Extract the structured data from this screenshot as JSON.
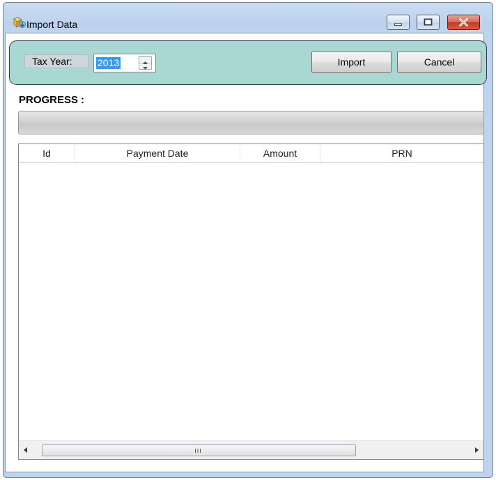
{
  "window": {
    "title": "Import Data",
    "icon": "import-data-icon",
    "caption_buttons": [
      "minimize-icon",
      "maximize-icon",
      "close-icon"
    ]
  },
  "toolbar": {
    "tax_year_label": "Tax Year:",
    "tax_year_value": "2013",
    "import_label": "Import",
    "cancel_label": "Cancel"
  },
  "progress": {
    "label": "PROGRESS :",
    "value_percent": 0
  },
  "table": {
    "columns": [
      "Id",
      "Payment Date",
      "Amount",
      "PRN"
    ],
    "rows": [],
    "scrollbar_grip": "III"
  },
  "colors": {
    "toolbar_background": "#a9d7d3",
    "selection": "#3399ff"
  }
}
